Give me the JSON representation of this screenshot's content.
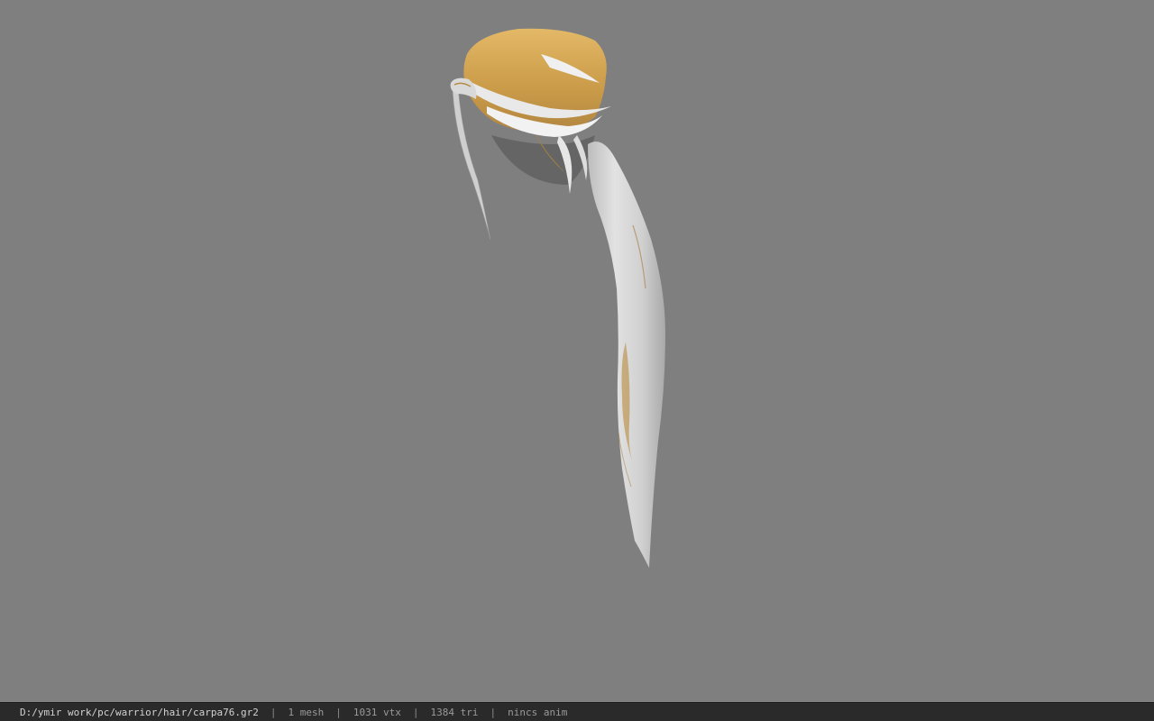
{
  "viewer": {
    "background_color": "#7f7f7f",
    "model": {
      "name": "hair-mesh",
      "hair_color": "#d4a24e",
      "tail_color": "#d6d6d6",
      "shading_color": "#a07a3a"
    }
  },
  "status_bar": {
    "file_path": "D:/ymir work/pc/warrior/hair/carpa76.gr2",
    "separator": "|",
    "mesh_count": "1 mesh",
    "vertex_count": "1031 vtx",
    "triangle_count": "1384 tri",
    "anim_status": "nincs anim"
  }
}
